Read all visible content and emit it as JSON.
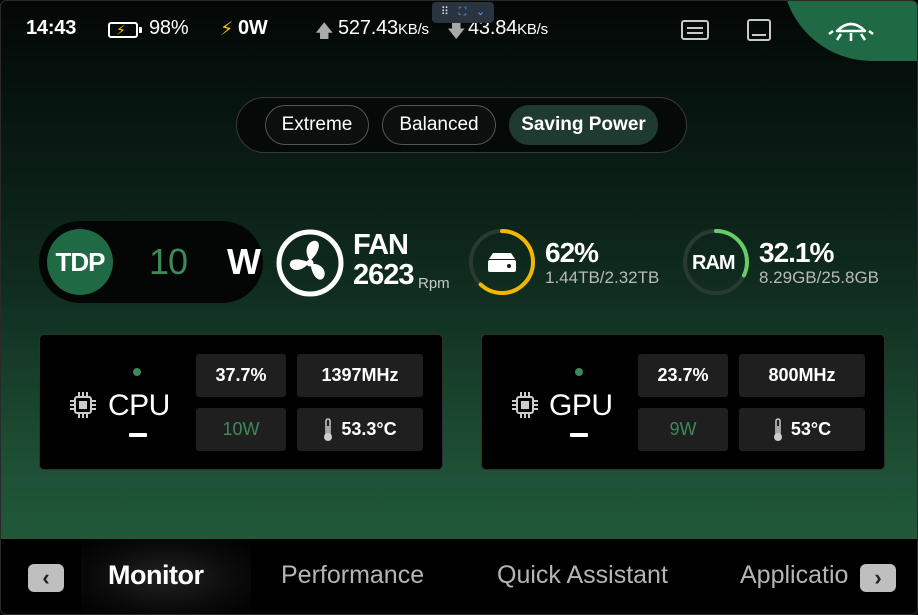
{
  "status": {
    "time": "14:43",
    "battery": "98%",
    "power": "0W",
    "upload_value": "527.43",
    "upload_unit": "KB/s",
    "download_value": "43.84",
    "download_unit": "KB/s"
  },
  "modes": [
    "Extreme",
    "Balanced",
    "Saving Power"
  ],
  "active_mode": "Saving Power",
  "tdp": {
    "label": "TDP",
    "value": "10",
    "unit": "W"
  },
  "fan": {
    "label": "FAN",
    "value": "2623",
    "unit": "Rpm"
  },
  "storage": {
    "percent": "62%",
    "detail": "1.44TB/2.32TB",
    "fraction": 0.62,
    "ring_color": "#f2b800"
  },
  "ram": {
    "label": "RAM",
    "percent": "32.1%",
    "detail": "8.29GB/25.8GB",
    "fraction": 0.321,
    "ring_color": "#66cc66"
  },
  "cpu": {
    "title": "CPU",
    "usage": "37.7%",
    "clock": "1397MHz",
    "power": "10W",
    "temp": "53.3°C"
  },
  "gpu": {
    "title": "GPU",
    "usage": "23.7%",
    "clock": "800MHz",
    "power": "9W",
    "temp": "53°C"
  },
  "nav": {
    "items": [
      "Monitor",
      "Performance",
      "Quick Assistant",
      "Applicatio"
    ],
    "active": "Monitor",
    "prev": "‹",
    "next": "›"
  },
  "colors": {
    "accent": "#1f6a44",
    "value_green": "#3c8a5a"
  }
}
